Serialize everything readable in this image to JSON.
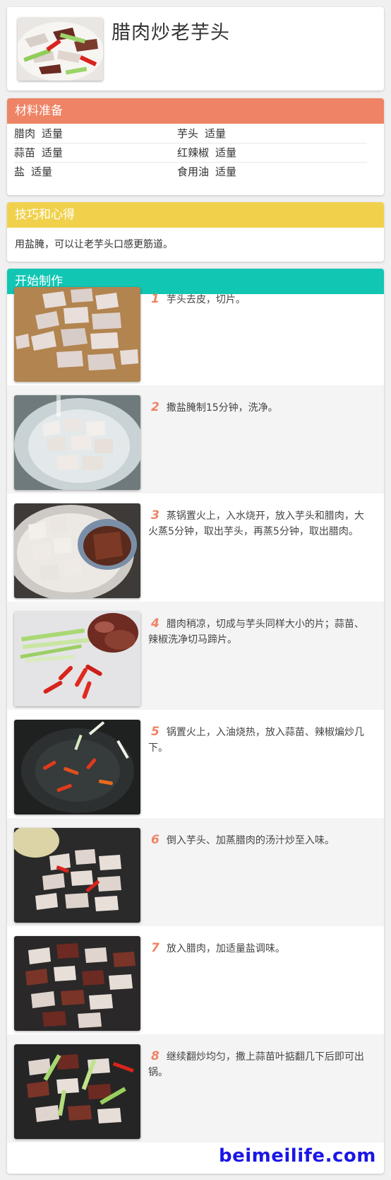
{
  "recipe": {
    "title": "腊肉炒老芋头",
    "cover_image": "finished-dish-photo"
  },
  "ingredients": {
    "heading": "材料准备",
    "rows": [
      [
        {
          "name": "腊肉",
          "amount": "适量"
        },
        {
          "name": "芋头",
          "amount": "适量"
        }
      ],
      [
        {
          "name": "蒜苗",
          "amount": "适量"
        },
        {
          "name": "红辣椒",
          "amount": "适量"
        }
      ],
      [
        {
          "name": "盐",
          "amount": "适量"
        },
        {
          "name": "食用油",
          "amount": "适量"
        }
      ]
    ]
  },
  "tips": {
    "heading": "技巧和心得",
    "text": "用盐腌，可以让老芋头口感更筋道。"
  },
  "steps": {
    "heading": "开始制作",
    "items": [
      {
        "num": "1",
        "text": "芋头去皮，切片。",
        "image": "sliced-taro-on-board"
      },
      {
        "num": "2",
        "text": "撒盐腌制15分钟，洗净。",
        "image": "taro-in-bowl"
      },
      {
        "num": "3",
        "text": "蒸锅置火上，入水烧开，放入芋头和腊肉，大火蒸5分钟，取出芋头，再蒸5分钟，取出腊肉。",
        "image": "steaming-taro-and-pork"
      },
      {
        "num": "4",
        "text": "腊肉稍凉，切成与芋头同样大小的片；蒜苗、辣椒洗净切马蹄片。",
        "image": "sliced-pork-garlic-chili"
      },
      {
        "num": "5",
        "text": "锅置火上，入油烧热，放入蒜苗、辣椒煸炒几下。",
        "image": "frying-chili-in-wok"
      },
      {
        "num": "6",
        "text": "倒入芋头、加蒸腊肉的汤汁炒至入味。",
        "image": "adding-taro-to-wok"
      },
      {
        "num": "7",
        "text": "放入腊肉，加适量盐调味。",
        "image": "adding-pork-to-wok"
      },
      {
        "num": "8",
        "text": "继续翻炒均匀，撒上蒜苗叶掂翻几下后即可出锅。",
        "image": "final-stir-fry"
      }
    ]
  },
  "watermark": "beimeilife.com",
  "colors": {
    "ingredients_bar": "#ee8465",
    "tips_bar": "#f1d14c",
    "steps_bar": "#12c6b4",
    "step_number": "#ee8465",
    "watermark": "#1b16e6"
  }
}
